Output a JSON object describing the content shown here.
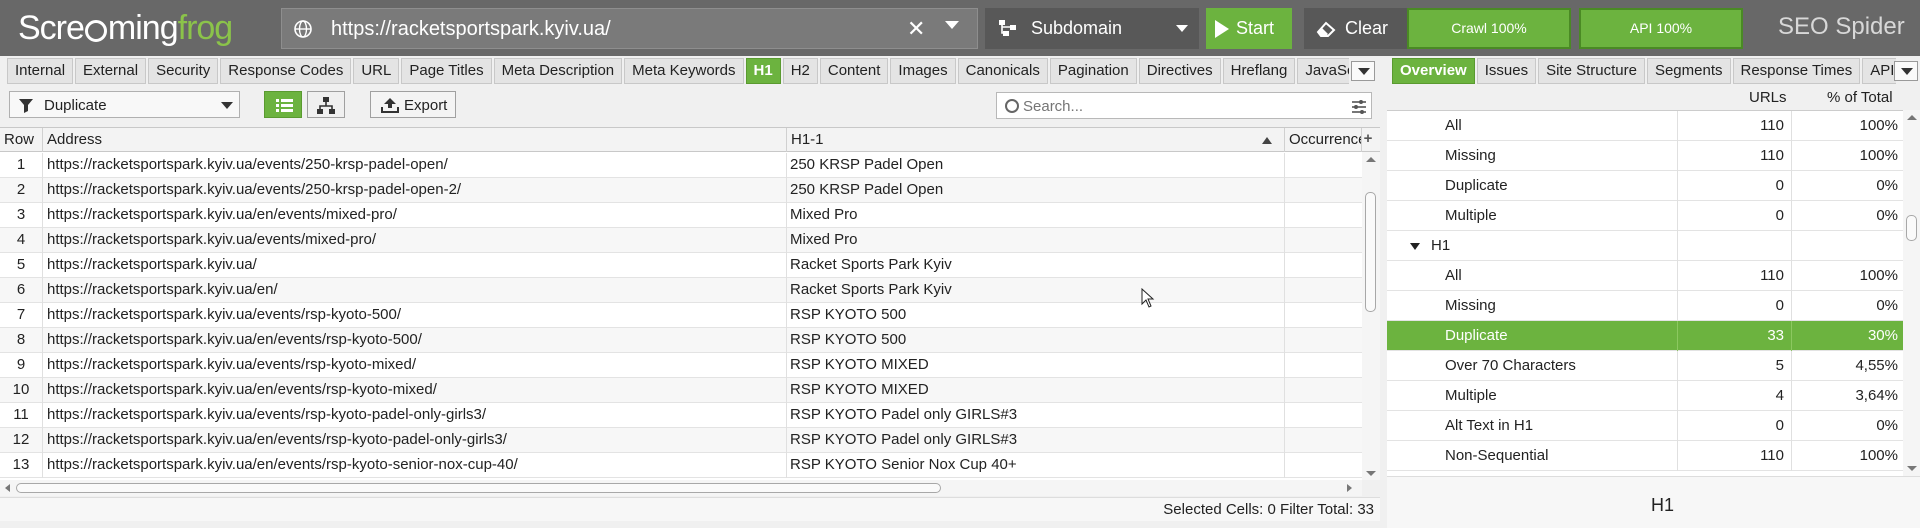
{
  "header": {
    "logo": {
      "part1": "Scre",
      "part2": "ming",
      "part3": "frog"
    },
    "url": "https://racketsportspark.kyiv.ua/",
    "mode": "Subdomain",
    "start_label": "Start",
    "clear_label": "Clear",
    "crawl_progress_label": "Crawl 100%",
    "crawl_progress": 100,
    "api_progress_label": "API 100%",
    "api_progress": 100,
    "product": "SEO Spider"
  },
  "left_tabs": [
    {
      "label": "Internal",
      "active": false
    },
    {
      "label": "External",
      "active": false
    },
    {
      "label": "Security",
      "active": false
    },
    {
      "label": "Response Codes",
      "active": false
    },
    {
      "label": "URL",
      "active": false
    },
    {
      "label": "Page Titles",
      "active": false
    },
    {
      "label": "Meta Description",
      "active": false
    },
    {
      "label": "Meta Keywords",
      "active": false
    },
    {
      "label": "H1",
      "active": true
    },
    {
      "label": "H2",
      "active": false
    },
    {
      "label": "Content",
      "active": false
    },
    {
      "label": "Images",
      "active": false
    },
    {
      "label": "Canonicals",
      "active": false
    },
    {
      "label": "Pagination",
      "active": false
    },
    {
      "label": "Directives",
      "active": false
    },
    {
      "label": "Hreflang",
      "active": false
    },
    {
      "label": "JavaScr",
      "active": false
    }
  ],
  "right_tabs": [
    {
      "label": "Overview",
      "active": true
    },
    {
      "label": "Issues",
      "active": false
    },
    {
      "label": "Site Structure",
      "active": false
    },
    {
      "label": "Segments",
      "active": false
    },
    {
      "label": "Response Times",
      "active": false
    },
    {
      "label": "API",
      "active": false
    }
  ],
  "toolbar": {
    "filter": "Duplicate",
    "export_label": "Export",
    "search_placeholder": "Search..."
  },
  "table": {
    "columns": [
      "Row",
      "Address",
      "H1-1",
      "Occurrence"
    ],
    "rows": [
      {
        "row": "1",
        "address": "https://racketsportspark.kyiv.ua/events/250-krsp-padel-open/",
        "h1": "250 KRSP Padel Open"
      },
      {
        "row": "2",
        "address": "https://racketsportspark.kyiv.ua/events/250-krsp-padel-open-2/",
        "h1": "250 KRSP Padel Open"
      },
      {
        "row": "3",
        "address": "https://racketsportspark.kyiv.ua/en/events/mixed-pro/",
        "h1": "Mixed Pro"
      },
      {
        "row": "4",
        "address": "https://racketsportspark.kyiv.ua/events/mixed-pro/",
        "h1": "Mixed Pro"
      },
      {
        "row": "5",
        "address": "https://racketsportspark.kyiv.ua/",
        "h1": "Racket Sports Park Kyiv"
      },
      {
        "row": "6",
        "address": "https://racketsportspark.kyiv.ua/en/",
        "h1": "Racket Sports Park Kyiv"
      },
      {
        "row": "7",
        "address": "https://racketsportspark.kyiv.ua/events/rsp-kyoto-500/",
        "h1": "RSP KYOTO 500"
      },
      {
        "row": "8",
        "address": "https://racketsportspark.kyiv.ua/en/events/rsp-kyoto-500/",
        "h1": "RSP KYOTO 500"
      },
      {
        "row": "9",
        "address": "https://racketsportspark.kyiv.ua/events/rsp-kyoto-mixed/",
        "h1": "RSP KYOTO MIXED"
      },
      {
        "row": "10",
        "address": "https://racketsportspark.kyiv.ua/en/events/rsp-kyoto-mixed/",
        "h1": "RSP KYOTO MIXED"
      },
      {
        "row": "11",
        "address": "https://racketsportspark.kyiv.ua/events/rsp-kyoto-padel-only-girls3/",
        "h1": "RSP KYOTO Padel only GIRLS#3"
      },
      {
        "row": "12",
        "address": "https://racketsportspark.kyiv.ua/en/events/rsp-kyoto-padel-only-girls3/",
        "h1": "RSP KYOTO Padel only GIRLS#3"
      },
      {
        "row": "13",
        "address": "https://racketsportspark.kyiv.ua/en/events/rsp-kyoto-senior-nox-cup-40/",
        "h1": "RSP KYOTO Senior Nox Cup 40+"
      }
    ]
  },
  "status": {
    "selected_cells_label": "Selected Cells:",
    "selected_cells": "0",
    "filter_total_label": "Filter Total:",
    "filter_total": "33"
  },
  "overview": {
    "col_urls": "URLs",
    "col_pct": "% of Total",
    "rows": [
      {
        "label": "All",
        "urls": "110",
        "pct": "100%",
        "type": "item"
      },
      {
        "label": "Missing",
        "urls": "110",
        "pct": "100%",
        "type": "item"
      },
      {
        "label": "Duplicate",
        "urls": "0",
        "pct": "0%",
        "type": "item"
      },
      {
        "label": "Multiple",
        "urls": "0",
        "pct": "0%",
        "type": "item"
      },
      {
        "label": "H1",
        "urls": "",
        "pct": "",
        "type": "group"
      },
      {
        "label": "All",
        "urls": "110",
        "pct": "100%",
        "type": "item"
      },
      {
        "label": "Missing",
        "urls": "0",
        "pct": "0%",
        "type": "item"
      },
      {
        "label": "Duplicate",
        "urls": "33",
        "pct": "30%",
        "type": "selected"
      },
      {
        "label": "Over 70 Characters",
        "urls": "5",
        "pct": "4,55%",
        "type": "item"
      },
      {
        "label": "Multiple",
        "urls": "4",
        "pct": "3,64%",
        "type": "item"
      },
      {
        "label": "Alt Text in H1",
        "urls": "0",
        "pct": "0%",
        "type": "item"
      },
      {
        "label": "Non-Sequential",
        "urls": "110",
        "pct": "100%",
        "type": "item"
      }
    ],
    "footer_title": "H1"
  },
  "colors": {
    "accent_green": "#6cb33f",
    "topbar_gray": "#686868"
  }
}
